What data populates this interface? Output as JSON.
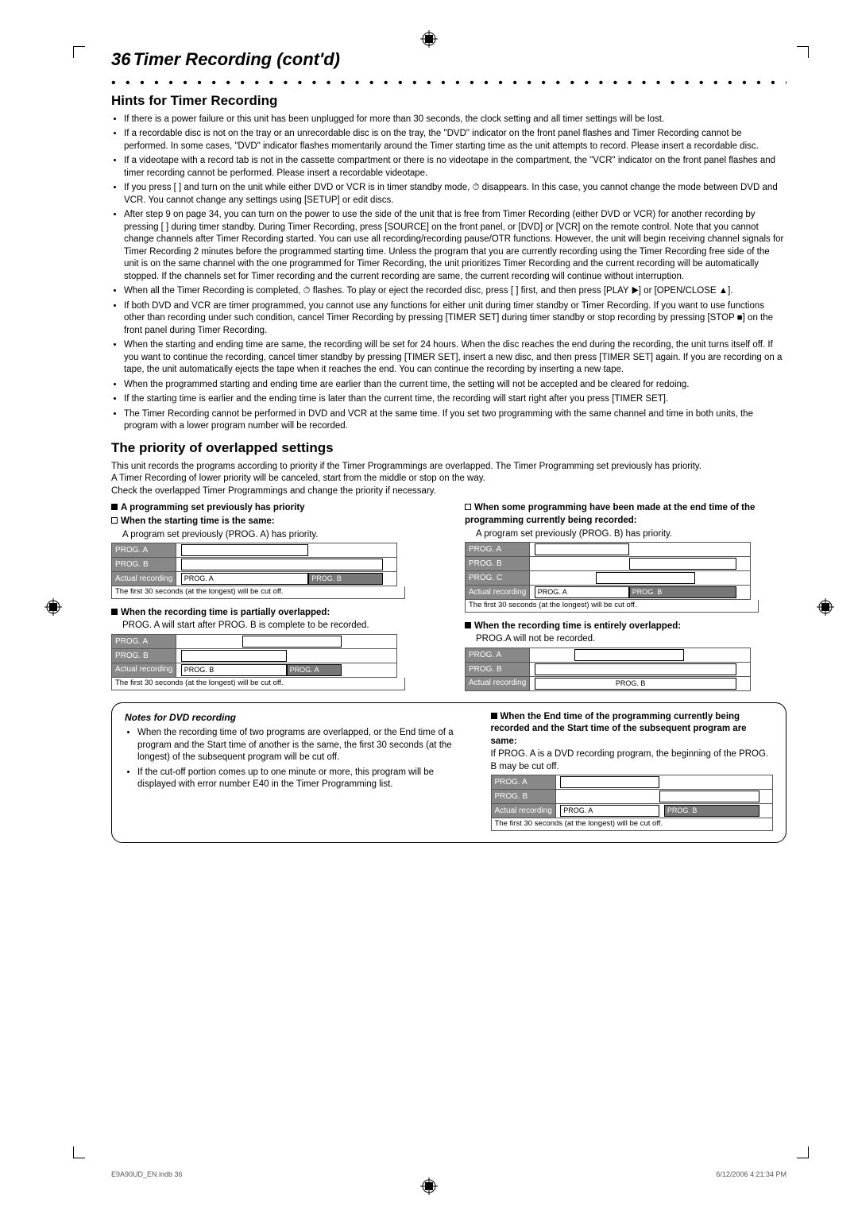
{
  "pageNumber": "36",
  "chapterTitle": "Timer Recording (cont'd)",
  "section1": {
    "title": "Hints for Timer Recording",
    "bullets": [
      "If there is a power failure or this unit has been unplugged for more than 30 seconds, the clock setting and all timer settings will be lost.",
      "If a recordable disc is not on the tray or an unrecordable disc is on the tray, the \"DVD\" indicator on the front panel flashes and Timer Recording cannot be performed. In some cases, \"DVD\" indicator flashes momentarily around the Timer starting time as the unit attempts to record. Please insert a recordable disc.",
      "If a videotape with a record tab is not in the cassette compartment or there is no videotape in the compartment, the \"VCR\" indicator on the front panel flashes and timer recording cannot be performed. Please insert a recordable videotape.",
      "If you press [  ] and turn on the unit while either DVD or VCR is in timer standby mode, ⏱ disappears. In this case, you cannot change the mode between DVD and VCR. You cannot change any settings using [SETUP] or edit discs.",
      "After step 9 on page 34, you can turn on the power to use the side of the unit that is free from Timer Recording (either DVD or VCR) for another recording by pressing [  ] during timer standby. During Timer Recording, press [SOURCE] on the front panel, or [DVD] or [VCR] on the remote control. Note that you cannot change channels after Timer Recording started. You can use all recording/recording pause/OTR functions. However, the unit will begin receiving channel signals for Timer Recording 2 minutes before the programmed starting time. Unless the program that you are currently recording using the Timer Recording free side of the unit is on the same channel with the one programmed for Timer Recording, the unit prioritizes Timer Recording and the current recording will be automatically stopped. If the channels set for Timer recording and the current recording are same, the current recording will continue without interruption.",
      "When all the Timer Recording is completed, ⏱ flashes. To play or eject the recorded disc, press [  ] first, and then press [PLAY ▶] or [OPEN/CLOSE ▲].",
      "If both DVD and VCR are timer programmed, you cannot use any functions for either unit during timer standby or Timer Recording. If you want to use functions other than recording under such condition, cancel Timer Recording by pressing [TIMER SET] during timer standby or stop recording by pressing [STOP ■] on the front panel during Timer Recording.",
      "When the starting and ending time are same, the recording will be set for 24 hours. When the disc reaches the end during the recording, the unit turns itself off. If you want to continue the recording, cancel timer standby by pressing [TIMER SET], insert a new disc, and then press [TIMER SET] again. If you are recording on a tape, the unit automatically ejects the tape when it reaches the end. You can continue the recording by inserting a new tape.",
      "When the programmed starting and ending time are earlier than the current time, the setting will not be accepted and be cleared for redoing.",
      "If the starting time is earlier and the ending time is later than the current time, the recording will start right after you press [TIMER SET].",
      "The Timer Recording cannot be performed in DVD and VCR at the same time. If you set two programming with the same channel and time in both units, the program with a lower program number will be recorded."
    ]
  },
  "section2": {
    "title": "The priority of overlapped settings",
    "intro1": "This unit records the programs according to priority if the Timer Programmings are overlapped. The Timer Programming set previously has priority.",
    "intro2": "A Timer Recording of lower priority will be canceled, start from the middle or stop on the way.",
    "intro3": "Check the overlapped Timer Programmings and change the priority if necessary."
  },
  "cases": {
    "a": {
      "head": "A programming set previously has priority",
      "sub": "When the starting time is the same:",
      "note": "A program set previously (PROG. A) has priority.",
      "rows": [
        "PROG. A",
        "PROG. B",
        "Actual recording"
      ],
      "rec": [
        "PROG. A",
        "PROG. B"
      ],
      "cut": "The first 30 seconds (at the longest) will be cut off."
    },
    "b": {
      "head": "When some programming have been made at the end time of the programming currently being recorded:",
      "note": "A program set previously (PROG. B) has priority.",
      "rows": [
        "PROG. A",
        "PROG. B",
        "PROG. C",
        "Actual recording"
      ],
      "rec": [
        "PROG. A",
        "PROG. B"
      ],
      "cut": "The first 30 seconds (at the longest) will be cut off."
    },
    "c": {
      "head": "When the recording time is partially overlapped:",
      "note": "PROG. A will start after PROG. B is complete to be recorded.",
      "rows": [
        "PROG. A",
        "PROG. B",
        "Actual recording"
      ],
      "rec": [
        "PROG. B",
        "PROG. A"
      ],
      "cut": "The first 30 seconds (at the longest) will be cut off."
    },
    "d": {
      "head": "When the recording time is entirely overlapped:",
      "note": "PROG.A will not be recorded.",
      "rows": [
        "PROG. A",
        "PROG. B",
        "Actual recording"
      ],
      "rec": [
        "PROG. B"
      ]
    }
  },
  "box": {
    "title": "Notes for DVD recording",
    "b1": "When the recording time of two programs are overlapped, or the End time of a program and the Start time of another is the same, the first 30 seconds (at the longest) of the subsequent program will be cut off.",
    "b2": "If the cut-off portion comes up to one minute or more, this program will be displayed with error number E40 in the Timer Programming list.",
    "rhead": "When the End time of the programming currently being recorded and the Start time of the subsequent program are same:",
    "rnote": "If PROG. A is a DVD recording program, the beginning of the PROG. B may be cut off.",
    "rows": [
      "PROG. A",
      "PROG. B",
      "Actual recording"
    ],
    "rec": [
      "PROG. A",
      "PROG. B"
    ],
    "cut": "The first 30 seconds (at the longest) will be cut off."
  },
  "footer": {
    "left": "E9A90UD_EN.indb   36",
    "right": "6/12/2006   4:21:34 PM"
  }
}
